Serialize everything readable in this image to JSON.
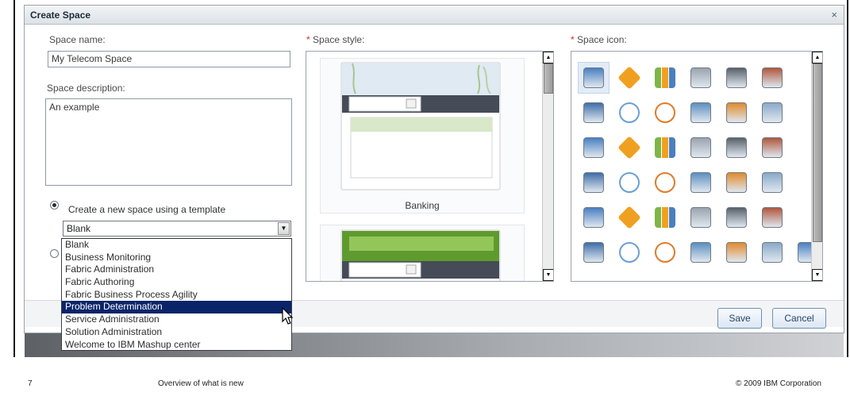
{
  "dialog": {
    "title": "Create Space",
    "close_label": "×"
  },
  "form": {
    "space_name_label": "Space name:",
    "space_name_value": "My Telecom Space",
    "description_label": "Space description:",
    "description_value": "An example",
    "radio_template_label": "Create a new space using a template",
    "template_selected": "Blank",
    "template_options": [
      "Blank",
      "Business Monitoring",
      "Fabric Administration",
      "Fabric Authoring",
      "Fabric Business Process Agility",
      "Problem Determination",
      "Service Administration",
      "Solution Administration",
      "Welcome to IBM Mashup center"
    ],
    "highlighted_option_index": 5
  },
  "style": {
    "required_mark": "*",
    "label": "Space style:",
    "items": [
      "Banking"
    ]
  },
  "icons": {
    "required_mark": "*",
    "label": "Space icon:",
    "selected_index": 0,
    "grid": [
      [
        "window-icon",
        "warning-icon",
        "bar-chart-icon",
        "service-bell-icon",
        "briefcase-icon",
        "books-icon"
      ],
      [
        "calculator-icon",
        "car-icon",
        "clock-icon",
        "network-icon",
        "mobile-phone-icon",
        "computer-icon"
      ],
      [
        "id-card-icon",
        "database-icon",
        "puzzle-icon",
        "form-icon",
        "rss-feed-icon",
        "documents-icon"
      ],
      [
        "globe-server-icon",
        "user-key-icon",
        "home-icon",
        "area-chart-icon",
        "line-chart-icon",
        "person-icon"
      ],
      [
        "businessman-icon",
        "customer-icon",
        "team-icon",
        "shopping-basket-icon",
        "laptop-icon",
        "trend-chart-icon"
      ],
      [
        "document-icon",
        "envelope-icon",
        "org-chart-icon",
        "shopping-cart-icon",
        "printer-icon",
        "folder-icon",
        "column-chart-icon"
      ]
    ]
  },
  "buttons": {
    "save": "Save",
    "cancel": "Cancel"
  },
  "slide": {
    "page_number": "7",
    "title": "Overview of what is new",
    "copyright": "© 2009 IBM  Corporation"
  }
}
